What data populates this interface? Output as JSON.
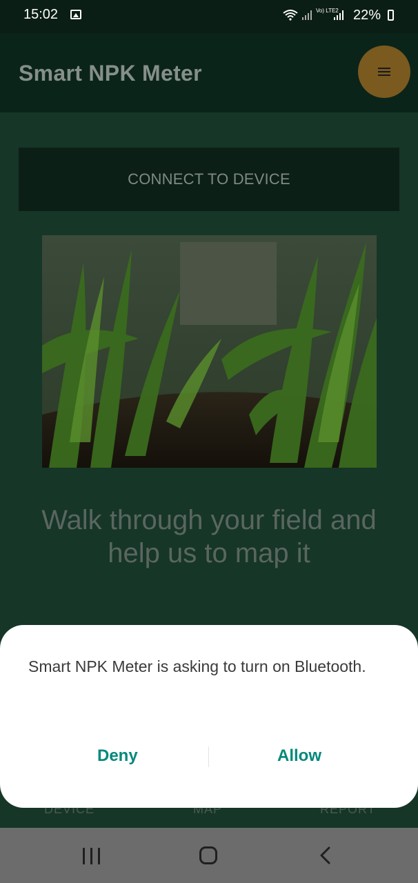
{
  "status_bar": {
    "time": "15:02",
    "volte": "Vo) LTE2",
    "battery": "22%"
  },
  "app_bar": {
    "title": "Smart NPK Meter"
  },
  "main": {
    "connect_button": "CONNECT TO DEVICE",
    "headline": "Walk through your field and help us to map it"
  },
  "bottom_nav": {
    "items": [
      "DEVICE",
      "MAP",
      "REPORT"
    ]
  },
  "dialog": {
    "message": "Smart NPK Meter is asking to turn on Bluetooth.",
    "deny": "Deny",
    "allow": "Allow"
  },
  "colors": {
    "dialog_accent": "#00897b",
    "fab": "#d89b2a",
    "scrim_bg": "#163627"
  },
  "icons": [
    "gallery-icon",
    "wifi-icon",
    "signal-icon",
    "battery-icon",
    "menu-icon",
    "recent-apps-icon",
    "home-icon",
    "back-icon"
  ]
}
